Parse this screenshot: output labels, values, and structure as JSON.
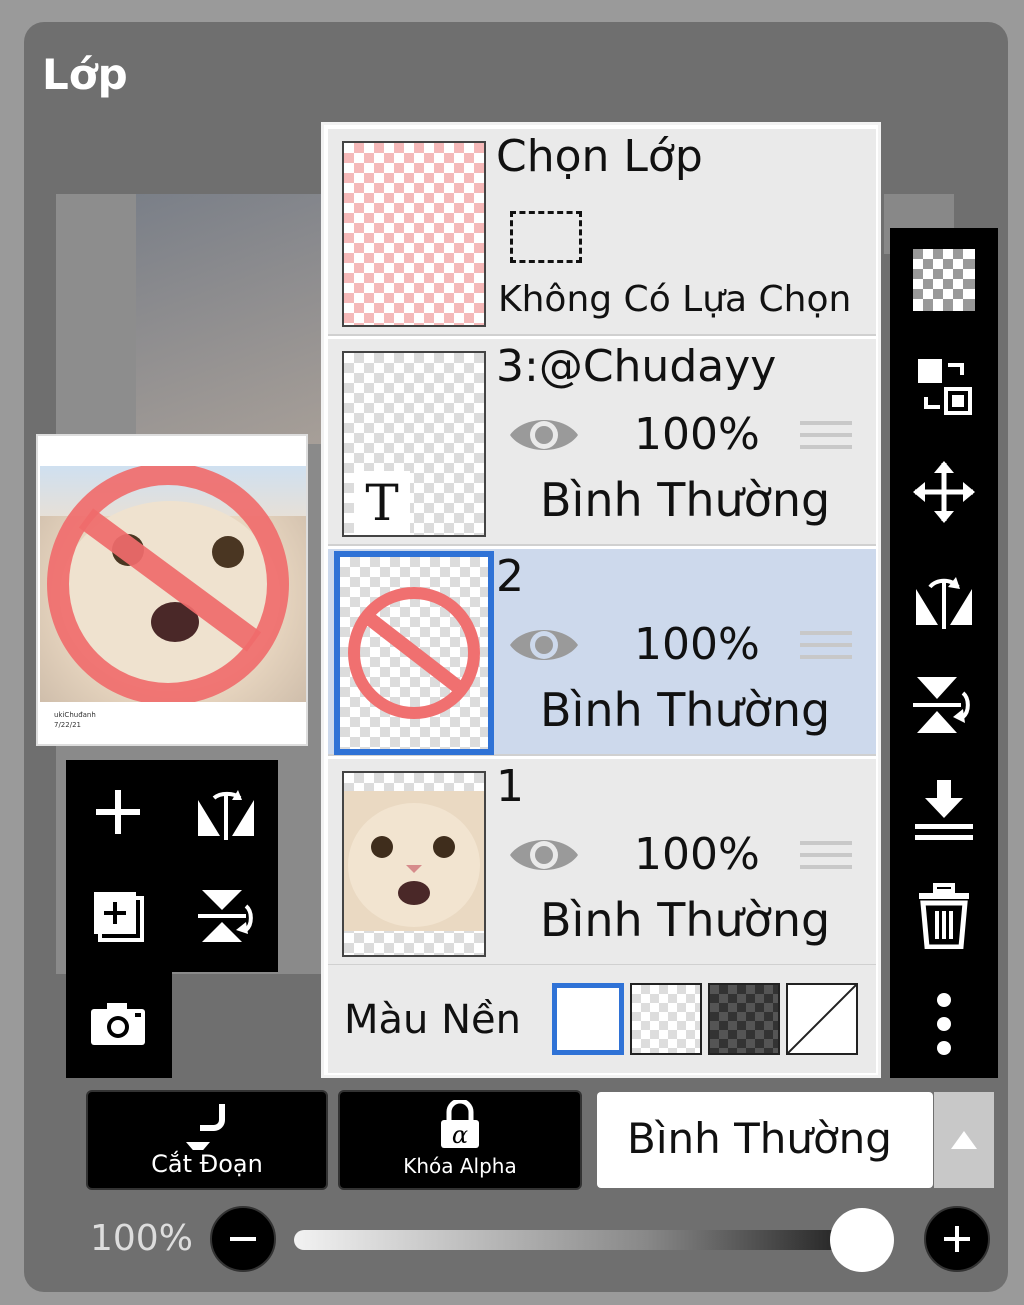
{
  "panel": {
    "title": "Lớp"
  },
  "preview": {
    "caption_line1": "ukiChuđanh",
    "caption_line2": "7/22/21"
  },
  "selection_row": {
    "title": "Chọn Lớp",
    "status": "Không Có Lựa Chọn"
  },
  "layers": [
    {
      "name": "3:@Chudayy",
      "opacity": "100%",
      "blend": "Bình Thường",
      "selected": false,
      "kind": "text",
      "visible": true
    },
    {
      "name": "2",
      "opacity": "100%",
      "blend": "Bình Thường",
      "selected": true,
      "kind": "no-sign",
      "visible": true
    },
    {
      "name": "1",
      "opacity": "100%",
      "blend": "Bình Thường",
      "selected": false,
      "kind": "photo",
      "visible": true
    }
  ],
  "background": {
    "label": "Màu Nền",
    "options": [
      "white",
      "transparent-light",
      "transparent-dark",
      "none"
    ],
    "selected": "white"
  },
  "bottom": {
    "clip_label": "Cắt Đoạn",
    "alpha_lock_label": "Khóa Alpha",
    "blend_mode_value": "Bình Thường"
  },
  "opacity_slider": {
    "label": "100%",
    "value": 1.0
  },
  "text_layer_glyph": "T",
  "colors": {
    "selection_blue": "#2f72d6",
    "selected_row": "#cdd9ec",
    "no_sign": "#f07070"
  }
}
